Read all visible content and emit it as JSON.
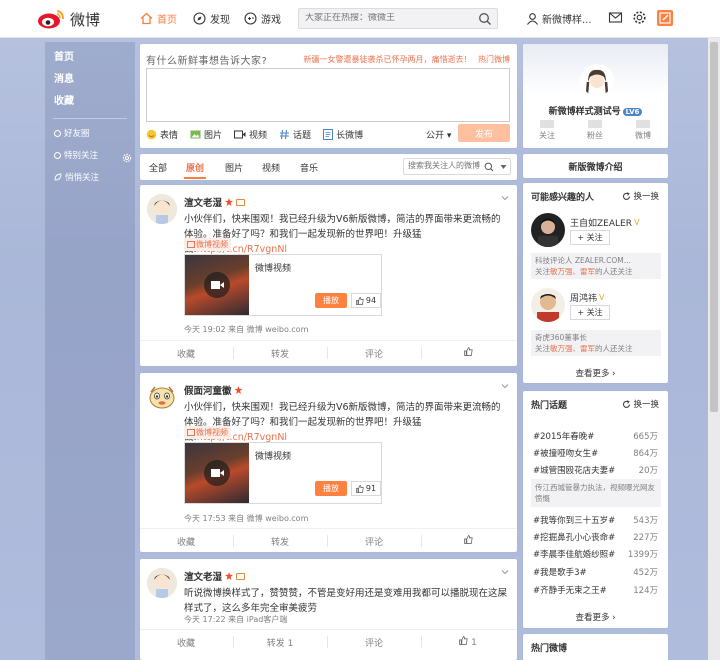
{
  "topnav": {
    "logo_text": "微博",
    "nav": [
      {
        "label": "首页",
        "icon": "home-icon"
      },
      {
        "label": "发现",
        "icon": "compass-icon"
      },
      {
        "label": "游戏",
        "icon": "gamepad-icon"
      }
    ],
    "search_placeholder": "大家正在热搜：微微王",
    "username": "新微博样...",
    "accent": "#fa7d3c"
  },
  "leftnav": {
    "items": [
      "首页",
      "消息",
      "收藏"
    ],
    "groups": [
      "好友圈",
      "特别关注",
      "悄悄关注"
    ]
  },
  "publisher": {
    "prompt": "有什么新鲜事想告诉大家?",
    "hot_topic": "新疆一女警遭暴徒袭杀已怀孕两月，痛惜逝去！",
    "hot_label": "热门微博",
    "tools": [
      "表情",
      "图片",
      "视频",
      "话题",
      "长微博"
    ],
    "visibility": "公开",
    "send_label": "发布"
  },
  "feed_tabs": {
    "tabs": [
      "全部",
      "原创",
      "图片",
      "视频",
      "音乐"
    ],
    "active": 1,
    "search_placeholder": "搜索我关注人的微博"
  },
  "feed": [
    {
      "author": "渲文老湿",
      "text": "小伙伴们，快来围观！我已经升级为V6新版微博，简洁的界面带来更流畅的体验。准备好了吗？和我们一起发现新的世界吧！升级猛戳:",
      "link": "http://t.cn/R7vgnNl",
      "tag": "微博视频",
      "video_title": "微博视频",
      "play_label": "播放",
      "likes": "94",
      "meta": "今天 19:02 来自 微博 weibo.com",
      "actions": [
        "收藏",
        "转发",
        "评论",
        ""
      ]
    },
    {
      "author": "假面河童徽",
      "text": "小伙伴们，快来围观！我已经升级为V6新版微博，简洁的界面带来更流畅的体验。准备好了吗？和我们一起发现新的世界吧！升级猛戳:",
      "link": "http://t.cn/R7vgnNl",
      "tag": "微博视频",
      "video_title": "微博视频",
      "play_label": "播放",
      "likes": "91",
      "meta": "今天 17:53 来自 微博 weibo.com",
      "actions": [
        "收藏",
        "转发",
        "评论",
        ""
      ]
    },
    {
      "author": "渲文老湿",
      "text": "听说微博换样式了，赞赞赞，不管是变好用还是变难用我都可以播脱现在这屎样式了，这么多年完全审美疲劳",
      "meta": "今天 17:22 来自 iPad客户端",
      "actions": [
        "收藏",
        "转发 1",
        "评论",
        "1"
      ]
    }
  ],
  "profile": {
    "name": "新微博样式测试号",
    "level": "LV6",
    "stats": [
      "关注",
      "粉丝",
      "微博"
    ]
  },
  "intro_label": "新版微博介绍",
  "recommend": {
    "title": "可能感兴趣的人",
    "refresh": "换一换",
    "people": [
      {
        "name": "王自如ZEALER",
        "follow": "+ 关注",
        "desc1": "科技评论人 ZEALER.COM...",
        "desc_pre": "关注",
        "desc_hl": "敏万强、雷军",
        "desc_post": "的人还关注"
      },
      {
        "name": "周鸿祎",
        "follow": "+ 关注",
        "desc1": "奇虎360董事长",
        "desc_pre": "关注",
        "desc_hl": "敏万强、雷军",
        "desc_post": "的人还关注"
      }
    ],
    "more": "查看更多 ›"
  },
  "hot_topics": {
    "title": "热门话题",
    "refresh": "换一换",
    "rows": [
      {
        "name": "#2015年春晚#",
        "count": "665万"
      },
      {
        "name": "#被撞哑吻女生#",
        "count": "864万"
      },
      {
        "name": "#城管围殴花店夫妻#",
        "count": "20万"
      },
      {
        "name": "#我等你到三十五岁#",
        "count": "543万"
      },
      {
        "name": "#挖掘鼻孔小心丧命#",
        "count": "227万"
      },
      {
        "name": "#李晨李佳航婚纱照#",
        "count": "1399万"
      },
      {
        "name": "#我是歌手3#",
        "count": "452万"
      },
      {
        "name": "#齐静手无束之王#",
        "count": "124万"
      }
    ],
    "desc": "传江西城管暴力执法，视频曝光网友愤慨",
    "more": "查看更多 ›"
  },
  "hot_weibo_title": "热门微博"
}
